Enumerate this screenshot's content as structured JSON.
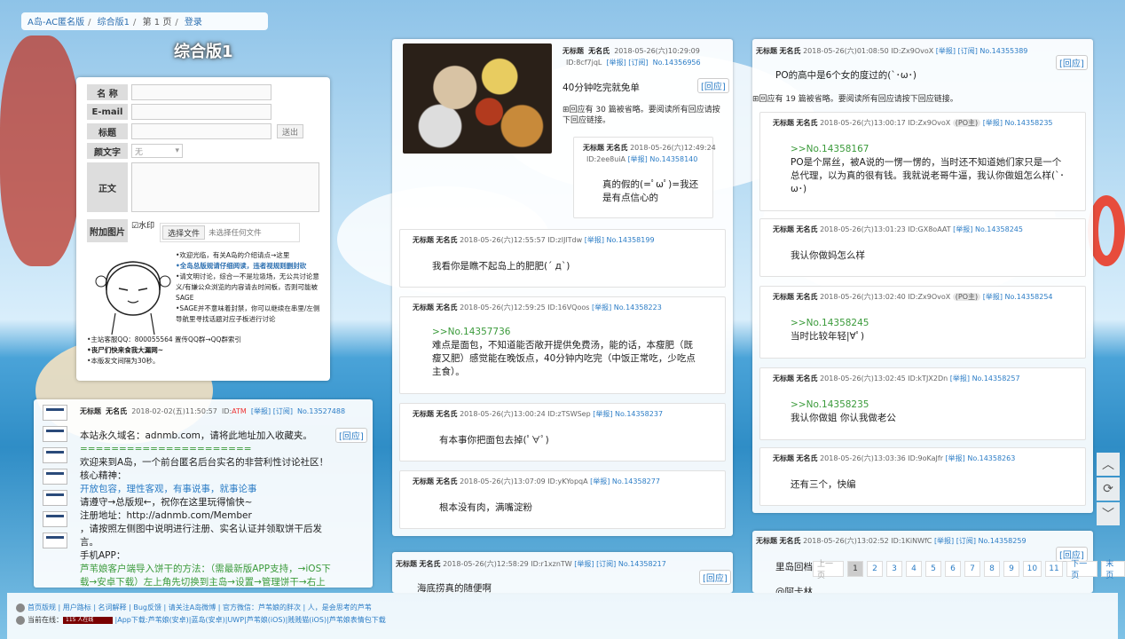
{
  "breadcrumb": {
    "site": "A岛-AC匿名版",
    "board": "综合版1",
    "page": "第 1 页",
    "login": "登录"
  },
  "board_title": "综合版1",
  "form": {
    "name_label": "名 称",
    "email_label": "E-mail",
    "subject_label": "标题",
    "send_button": "送出",
    "emoticon_label": "颜文字",
    "emoticon_value": "无",
    "body_label": "正文",
    "image_label": "附加图片",
    "watermark_label": "水印",
    "file_button": "选择文件",
    "file_status": "未选择任何文件",
    "notes": [
      "•欢迎光临，有关A岛的介绍请点→这里",
      "•全岛总版规请仔细阅读，违者视规则删封砍",
      "•请文明讨论，综合一不是垃圾场，无公共讨论意义/有嫌公众浏览的内容请去时间板，否则可能被SAGE",
      "•SAGE并不意味着封禁，你可以继续在串里/左侧导航里寻找话题对应子板进行讨论",
      "•主站客服QQ：800055564 置传QQ群→QQ群索引",
      "•丧尸们快来食我大漏网~",
      "•本版发文间隔为30秒。"
    ]
  },
  "threads": {
    "announcement": {
      "title": "无标题",
      "name": "无名氏",
      "time": "2018-02-02(五)11:50:57",
      "id_prefix": "ID:",
      "id": "ATM",
      "report": "[举报]",
      "subscribe": "[订阅]",
      "no": "No.13527488",
      "reply": "[回应]",
      "lines": [
        "本站永久域名：adnmb.com，请将此地址加入收藏夹。",
        "======================",
        "欢迎来到A岛，一个前台匿名后台实名的非营利性讨论社区！",
        "核心精神：",
        "开放包容，理性客观，有事说事，就事论事",
        "请遵守→总版规←，祝你在这里玩得愉快~",
        "注册地址：http://adnmb.com/Member",
        "，请按照左侧图中说明进行注册、实名认证并领取饼干后发言。",
        "手机APP：",
        "芦苇娘客户端导入饼干的方法：（需最新版APP支持，→iOS下载→安卓下载）左上角先切换到主岛→设置→管理饼干→右上角的+号→扫后台领取饼干后生成的二维码即可"
      ]
    },
    "food": {
      "title": "无标题",
      "name": "无名氏",
      "time": "2018-05-26(六)10:29:09",
      "id": "ID:8cf7jqL",
      "report": "[举报]",
      "subscribe": "[订阅]",
      "no": "No.14356956",
      "reply": "[回应]",
      "body": "40分钟吃完就免单",
      "omitted": "回应有 30 篇被省略。要阅读所有回应请按下回应链接。",
      "replies": [
        {
          "title": "无标题",
          "name": "无名氏",
          "time": "2018-05-26(六)12:49:24",
          "id": "ID:2ee8uiA",
          "report": "[举报]",
          "no": "No.14358140",
          "body": "真的假的(=ﾟωﾟ)=我还是有点信心的"
        },
        {
          "title": "无标题",
          "name": "无名氏",
          "time": "2018-05-26(六)12:55:57",
          "id": "ID:zIJlTdw",
          "report": "[举报]",
          "no": "No.14358199",
          "body": "我看你是瞧不起岛上的肥肥(´ д`)"
        },
        {
          "title": "无标题",
          "name": "无名氏",
          "time": "2018-05-26(六)12:59:25",
          "id": "ID:16VQoos",
          "report": "[举报]",
          "no": "No.14358223",
          "quote": ">>No.14357736",
          "body": "难点是面包，不知道能否敞开提供免费汤，能的话，本瘦肥（既瘦又肥）感觉能在晚饭点，40分钟内吃完（中饭正常吃，少吃点主食）。"
        },
        {
          "title": "无标题",
          "name": "无名氏",
          "time": "2018-05-26(六)13:00:24",
          "id": "ID:zTSWSep",
          "report": "[举报]",
          "no": "No.14358237",
          "body": "有本事你把面包去掉(ﾟ∀ﾟ)"
        },
        {
          "title": "无标题",
          "name": "无名氏",
          "time": "2018-05-26(六)13:07:09",
          "id": "ID:yKYopqA",
          "report": "[举报]",
          "no": "No.14358277",
          "body": "根本没有肉，满嘴淀粉"
        }
      ]
    },
    "seafood": {
      "title": "无标题",
      "name": "无名氏",
      "time": "2018-05-26(六)12:58:29",
      "id": "ID:r1xznTW",
      "report": "[举报]",
      "subscribe": "[订阅]",
      "no": "No.14358217",
      "reply": "[回应]",
      "body": "海底捞真的随便啊"
    },
    "po": {
      "title": "无标题",
      "name": "无名氏",
      "time": "2018-05-26(六)01:08:50",
      "id": "ID:Zx9OvoX",
      "report": "[举报]",
      "subscribe": "[订阅]",
      "no": "No.14355389",
      "reply": "[回应]",
      "body": "PO的高中是6个女的度过的(`･ω･)",
      "omitted": "回应有 19 篇被省略。要阅读所有回应请按下回应链接。",
      "replies": [
        {
          "title": "无标题",
          "name": "无名氏",
          "time": "2018-05-26(六)13:00:17",
          "id": "ID:Zx9OvoX",
          "po": "(PO主)",
          "report": "[举报]",
          "no": "No.14358235",
          "quote": ">>No.14358167",
          "body": "PO是个屌丝，被A说的一愣一愣的，当时还不知道她们家只是一个总代理，以为真的很有钱。我就说老哥牛逼，我认你做姐怎么样(`･ω･)"
        },
        {
          "title": "无标题",
          "name": "无名氏",
          "time": "2018-05-26(六)13:01:23",
          "id": "ID:GX8oAAT",
          "report": "[举报]",
          "no": "No.14358245",
          "body": "我认你做妈怎么样"
        },
        {
          "title": "无标题",
          "name": "无名氏",
          "time": "2018-05-26(六)13:02:40",
          "id": "ID:Zx9OvoX",
          "po": "(PO主)",
          "report": "[举报]",
          "no": "No.14358254",
          "quote": ">>No.14358245",
          "body": "当时比较年轻|∀ﾟ)"
        },
        {
          "title": "无标题",
          "name": "无名氏",
          "time": "2018-05-26(六)13:02:45",
          "id": "ID:kTJX2Dn",
          "report": "[举报]",
          "no": "No.14358257",
          "quote": ">>No.14358235",
          "body": "我认你做姐 你认我做老公"
        },
        {
          "title": "无标题",
          "name": "无名氏",
          "time": "2018-05-26(六)13:03:36",
          "id": "ID:9oKaJfr",
          "report": "[举报]",
          "no": "No.14358263",
          "body": "还有三个，快编"
        }
      ]
    },
    "bottom_right": {
      "title": "无标题",
      "name": "无名氏",
      "time": "2018-05-26(六)13:02:52",
      "id": "ID:1KiNWfC",
      "report": "[举报]",
      "subscribe": "[订阅]",
      "no": "No.14358259",
      "reply": "[回应]",
      "body": "里岛回档",
      "body2": "@阿卡林"
    }
  },
  "pager": [
    "上一页",
    "1",
    "2",
    "3",
    "4",
    "5",
    "6",
    "7",
    "8",
    "9",
    "10",
    "11",
    "下一页",
    "末页"
  ],
  "footer": {
    "line1": "首页版规 | 用户路标 | 名词解释 | Bug反馈 | 请关注A岛微博 | 官方微信：芦苇娘的胖次 | 人，是会思考的芦苇",
    "online_label": "当前在线：",
    "online_value": "115 人在线",
    "line2": "|App下载:芦苇娘(安卓)|蓝岛(安卓)|UWP|芦苇娘(iOS)|贱贱猫(iOS)|芦苇娘表情包下载"
  }
}
